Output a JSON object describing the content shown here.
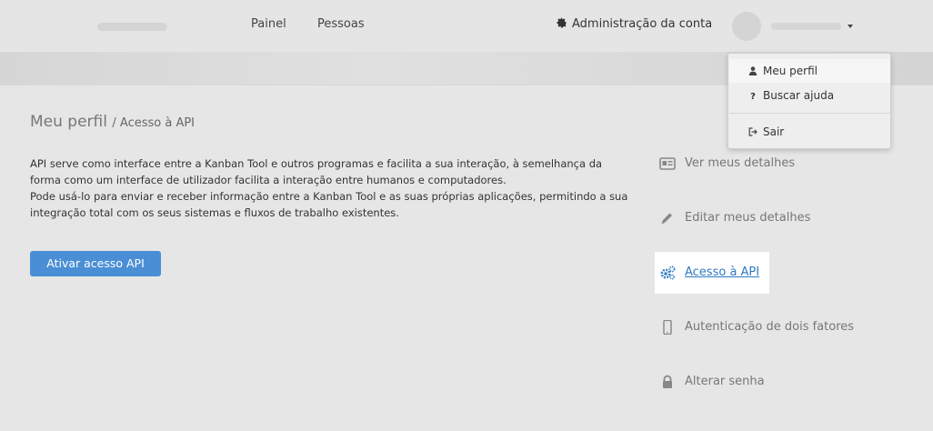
{
  "header": {
    "nav": [
      "Painel",
      "Pessoas"
    ],
    "account_admin": "Administração da conta",
    "icons": {
      "admin": "gear-icon",
      "caret": "caret-down-icon"
    }
  },
  "dropdown": {
    "items": [
      {
        "label": "Meu perfil",
        "icon": "user-icon"
      },
      {
        "label": "Buscar ajuda",
        "icon": "question-icon"
      },
      {
        "label": "Sair",
        "icon": "sign-out-icon"
      }
    ]
  },
  "page": {
    "title": "Meu perfil",
    "subtitle": "/ Acesso à API",
    "description": [
      "API serve como interface entre a Kanban Tool e outros programas e facilita a sua interação, à semelhança da forma como um interface de utilizador facilita a interação entre humanos e computadores.",
      "Pode usá-lo para enviar e receber informação entre a Kanban Tool e as suas próprias aplicações, permitindo a sua integração total com os seus sistemas e fluxos de trabalho existentes."
    ],
    "activate_button": "Ativar acesso API"
  },
  "sidebar": {
    "items": [
      {
        "label": "Ver meus detalhes",
        "icon": "id-card-icon"
      },
      {
        "label": "Editar meus detalhes",
        "icon": "pencil-icon"
      },
      {
        "label": "Acesso à API",
        "icon": "gears-icon",
        "active": true
      },
      {
        "label": "Autenticação de dois fatores",
        "icon": "mobile-phone-icon"
      },
      {
        "label": "Alterar senha",
        "icon": "lock-icon"
      }
    ]
  },
  "colors": {
    "accent": "#4a8fd6",
    "link_active": "#2f7ac4",
    "background": "#e5e5e5"
  }
}
